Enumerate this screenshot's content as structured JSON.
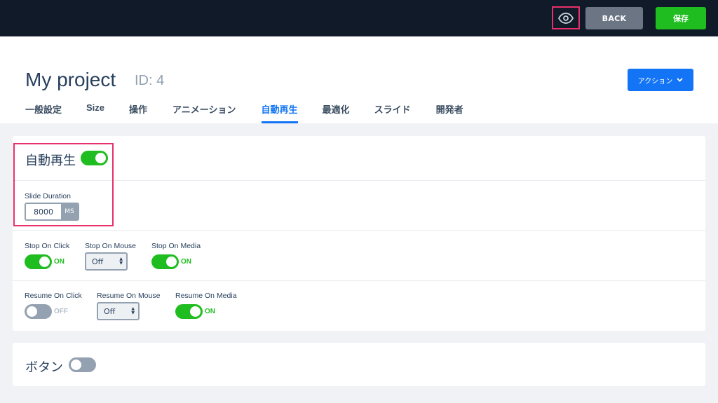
{
  "topbar": {
    "preview_icon": "eye-icon",
    "back_label": "BACK",
    "save_label": "保存"
  },
  "header": {
    "title": "My project",
    "id_label": "ID: 4",
    "action_label": "アクション",
    "action_icon": "chevron-down-icon",
    "tabs": [
      {
        "label": "一般設定"
      },
      {
        "label": "Size"
      },
      {
        "label": "操作"
      },
      {
        "label": "アニメーション"
      },
      {
        "label": "自動再生",
        "active": true
      },
      {
        "label": "最適化"
      },
      {
        "label": "スライド"
      },
      {
        "label": "開発者"
      }
    ]
  },
  "autoplay": {
    "title": "自動再生",
    "enabled": true,
    "slide_duration": {
      "label": "Slide Duration",
      "value": "8000",
      "unit": "MS"
    },
    "stop_on_click": {
      "label": "Stop On Click",
      "state": "ON"
    },
    "stop_on_mouse": {
      "label": "Stop On Mouse",
      "value": "Off"
    },
    "stop_on_media": {
      "label": "Stop On Media",
      "state": "ON"
    },
    "resume_on_click": {
      "label": "Resume On Click",
      "state": "OFF"
    },
    "resume_on_mouse": {
      "label": "Resume On Mouse",
      "value": "Off"
    },
    "resume_on_media": {
      "label": "Resume On Media",
      "state": "ON"
    }
  },
  "button_section": {
    "title": "ボタン",
    "enabled": false
  },
  "colors": {
    "topbar": "#101a28",
    "accent_blue": "#1375f5",
    "toggle_on": "#1fbd1f",
    "toggle_off": "#93a1b1",
    "highlight": "#e8306a"
  }
}
